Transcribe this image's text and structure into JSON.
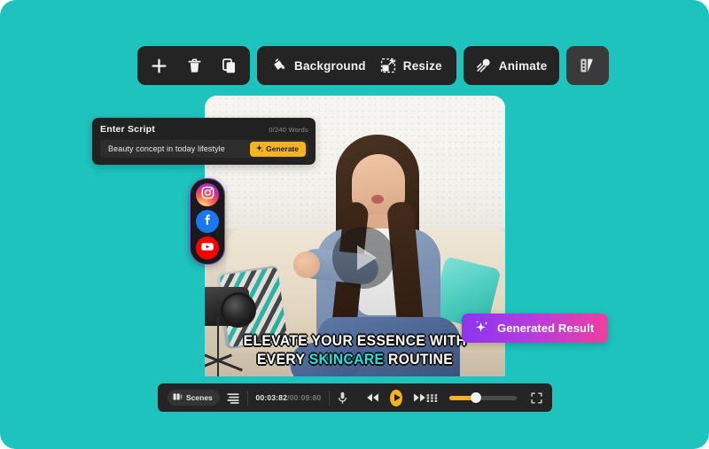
{
  "theme": {
    "background": "#1ec3bd",
    "panel_dark": "#242424",
    "accent_yellow": "#f5b324",
    "accent_cyan": "#2ce0e0",
    "gradient_start": "#8b35f0",
    "gradient_end": "#ef3f9e"
  },
  "toolbar": {
    "groups": [
      {
        "name": "edit-actions",
        "items": [
          {
            "label": "",
            "icon": "plus-icon",
            "name": "add-button"
          },
          {
            "label": "",
            "icon": "trash-icon",
            "name": "delete-button"
          },
          {
            "label": "",
            "icon": "duplicate-icon",
            "name": "duplicate-button"
          }
        ]
      },
      {
        "name": "canvas-actions",
        "items": [
          {
            "label": "Background",
            "icon": "paint-bucket-icon",
            "name": "background-button"
          },
          {
            "label": "Resize",
            "icon": "resize-icon",
            "name": "resize-button"
          }
        ]
      },
      {
        "name": "animate-actions",
        "items": [
          {
            "label": "Animate",
            "icon": "magic-wand-icon",
            "name": "animate-button"
          }
        ]
      },
      {
        "name": "style-actions",
        "items": [
          {
            "label": "",
            "icon": "color-palette-icon",
            "name": "styles-button"
          }
        ]
      }
    ]
  },
  "script_panel": {
    "title": "Enter Script",
    "word_count": "0/240 Words",
    "input_value": "Beauty concept in today lifestyle",
    "input_placeholder": "Beauty concept in today lifestyle",
    "generate_label": "Generate",
    "generate_icon": "sparkle-icon"
  },
  "social_rail": {
    "items": [
      {
        "name": "instagram-button",
        "icon": "instagram-icon",
        "label": "Instagram"
      },
      {
        "name": "facebook-button",
        "icon": "facebook-icon",
        "label": "Facebook"
      },
      {
        "name": "youtube-button",
        "icon": "youtube-icon",
        "label": "YouTube"
      }
    ]
  },
  "video": {
    "play_overlay_icon": "play-icon",
    "caption": {
      "line1": "ELEVATE YOUR ESSENCE WITH",
      "line2_before": "EVERY ",
      "line2_highlight": "SKINCARE",
      "line2_after": " ROUTINE"
    }
  },
  "generated_result": {
    "label": "Generated Result",
    "icon": "sparkle-icon"
  },
  "controls": {
    "scenes_label": "Scenes",
    "scenes_icon": "scenes-icon",
    "list_icon": "layers-list-icon",
    "current_time": "00:03:82",
    "time_separator": "/",
    "total_time": "00:09:80",
    "mic_icon": "microphone-icon",
    "rewind_icon": "rewind-icon",
    "play_icon": "play-icon",
    "forward_icon": "fast-forward-icon",
    "grid_icon": "grid-icon",
    "fullscreen_icon": "fullscreen-icon",
    "zoom_value": "40"
  }
}
